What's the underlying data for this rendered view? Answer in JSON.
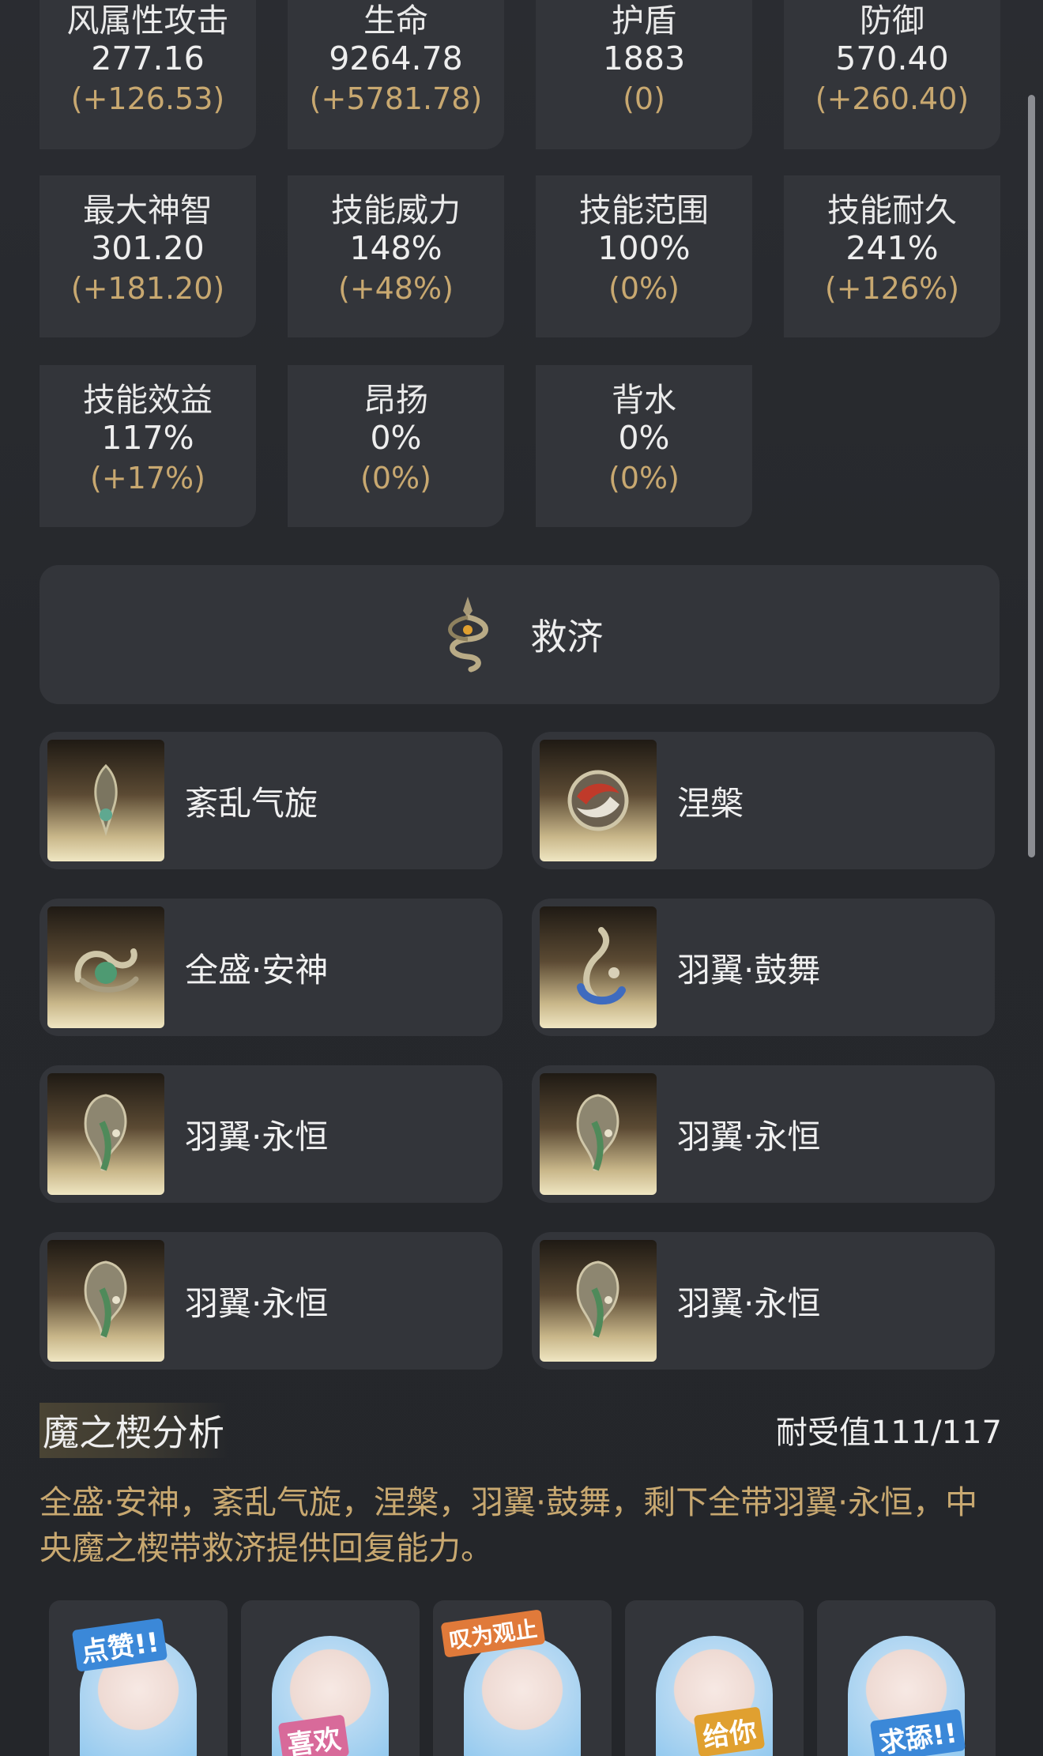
{
  "stats": [
    {
      "label": "风属性攻击",
      "value": "277.16",
      "bonus": "(+126.53)"
    },
    {
      "label": "生命",
      "value": "9264.78",
      "bonus": "(+5781.78)"
    },
    {
      "label": "护盾",
      "value": "1883",
      "bonus": "(0)"
    },
    {
      "label": "防御",
      "value": "570.40",
      "bonus": "(+260.40)"
    },
    {
      "label": "最大神智",
      "value": "301.20",
      "bonus": "(+181.20)"
    },
    {
      "label": "技能威力",
      "value": "148%",
      "bonus": "(+48%)"
    },
    {
      "label": "技能范围",
      "value": "100%",
      "bonus": "(0%)"
    },
    {
      "label": "技能耐久",
      "value": "241%",
      "bonus": "(+126%)"
    },
    {
      "label": "技能效益",
      "value": "117%",
      "bonus": "(+17%)"
    },
    {
      "label": "昂扬",
      "value": "0%",
      "bonus": "(0%)"
    },
    {
      "label": "背水",
      "value": "0%",
      "bonus": "(0%)"
    }
  ],
  "central": {
    "title": "救济",
    "icon": "serpent-emblem-icon"
  },
  "mods": [
    {
      "name": "紊乱气旋",
      "icon": "cyclone-mod-icon"
    },
    {
      "name": "涅槃",
      "icon": "nirvana-mod-icon"
    },
    {
      "name": "全盛·安神",
      "icon": "serpent-mod-icon"
    },
    {
      "name": "羽翼·鼓舞",
      "icon": "wing-mod-icon"
    },
    {
      "name": "羽翼·永恒",
      "icon": "mask-mod-icon"
    },
    {
      "name": "羽翼·永恒",
      "icon": "mask-mod-icon"
    },
    {
      "name": "羽翼·永恒",
      "icon": "mask-mod-icon"
    },
    {
      "name": "羽翼·永恒",
      "icon": "mask-mod-icon"
    }
  ],
  "analysis": {
    "title": "魔之楔分析",
    "endurance": "耐受值111/117",
    "text": "全盛·安神，紊乱气旋，涅槃，羽翼·鼓舞，剩下全带羽翼·永恒，中央魔之楔带救济提供回复能力。"
  },
  "stickers": [
    {
      "caption": "点赞!!"
    },
    {
      "caption": "喜欢"
    },
    {
      "caption": "叹为观止"
    },
    {
      "caption": "给你"
    },
    {
      "caption": "求舔!!"
    }
  ],
  "colors": {
    "accent": "#c8a870",
    "card": "#33353a",
    "background": "#26282c"
  }
}
